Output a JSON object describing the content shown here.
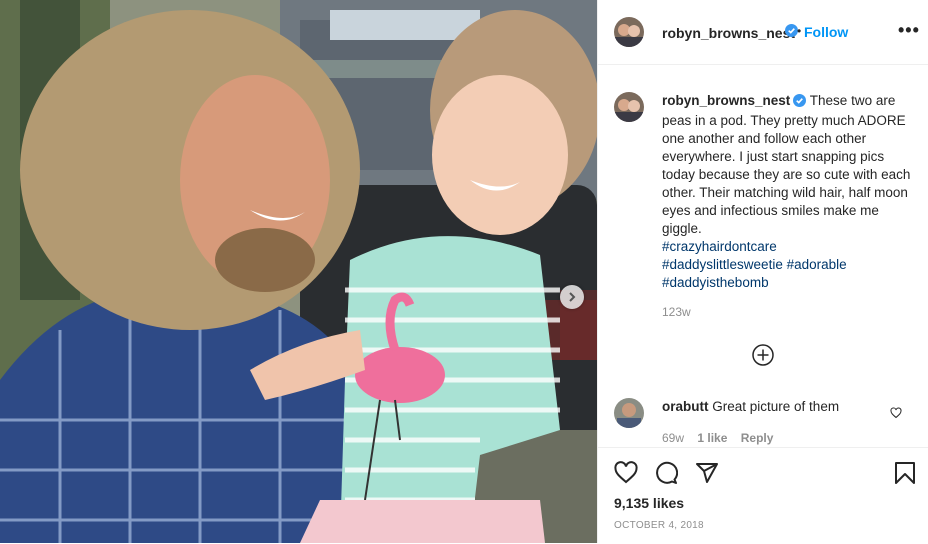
{
  "post": {
    "author": "robyn_browns_nest",
    "follow_label": "Follow",
    "separator": "•",
    "more_label": "•••",
    "caption_text": "These two are peas in a pod. They pretty much ADORE one another and follow each other everywhere. I just start snapping pics today because they are so cute with each other. Their matching wild hair, half moon eyes and infectious smiles make me giggle.",
    "hashtags": [
      "#crazyhairdontcare",
      "#daddyslittlesweetie",
      "#adorable",
      "#daddyisthebomb"
    ],
    "time_ago": "123w",
    "likes": "9,135 likes",
    "date": "OCTOBER 4, 2018"
  },
  "comments": [
    {
      "user": "orabutt",
      "text": "Great picture of them",
      "age": "69w",
      "likes": "1 like",
      "reply": "Reply"
    }
  ],
  "icons": {
    "verified": "verified-badge-icon",
    "like": "heart-icon",
    "comment": "comment-icon",
    "share": "paper-plane-icon",
    "save": "bookmark-icon",
    "next": "chevron-right-icon",
    "load_more": "plus-circle-icon"
  },
  "colors": {
    "accent": "#0095f6",
    "text": "#262626",
    "muted": "#8e8e8e",
    "verified": "#3897f0"
  }
}
